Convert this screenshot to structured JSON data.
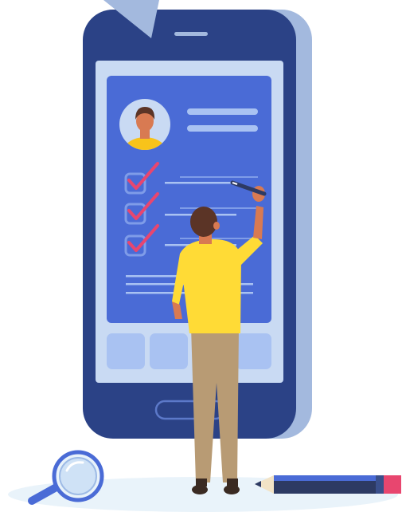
{
  "illustration": {
    "subject": "person-checking-off-checklist-on-giant-smartphone",
    "checklist_items": [
      {
        "checked": true
      },
      {
        "checked": true
      },
      {
        "checked": true
      }
    ],
    "colors": {
      "phone_body": "#2B4286",
      "phone_side": "#A3B9DE",
      "screen_bg": "#C9DAF3",
      "card_bg": "#4A6BD6",
      "card_line": "#A9C2F2",
      "checkbox": "#7F9CE8",
      "checkmark": "#E8466F",
      "avatar_bg": "#C9DAF3",
      "avatar_shirt": "#F8C31A",
      "shirt": "#FFDB36",
      "pants": "#B89B74",
      "hair": "#5B3426",
      "skin": "#D87A52",
      "floor": "#E9F3FA",
      "pencil_body": "#2D3A63",
      "pencil_eraser": "#E8466F",
      "magnifier_handle": "#4A6BD6",
      "magnifier_lens": "#CFE2F6"
    },
    "icons": [
      "avatar-icon",
      "check-icon",
      "magnifying-glass-icon",
      "pencil-icon",
      "marker-icon"
    ]
  }
}
